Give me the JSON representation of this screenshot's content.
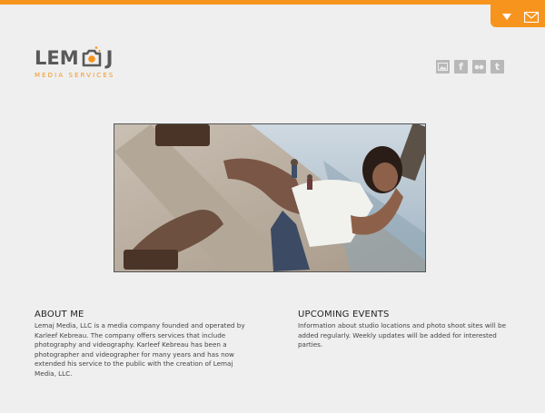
{
  "logo": {
    "left_text": "LEM",
    "right_text": "J",
    "tagline": "MEDIA SERVICES"
  },
  "top_tab": {
    "icons": [
      "dropdown-arrow-icon",
      "mail-icon"
    ]
  },
  "social": {
    "icons": [
      "image-gallery-icon",
      "facebook-icon",
      "flickr-icon",
      "twitter-icon"
    ],
    "facebook_glyph": "f",
    "twitter_glyph": "t"
  },
  "colors": {
    "accent": "#f7941d",
    "background": "#efefef",
    "icon_gray": "#b8b8b8",
    "logo_gray": "#595959"
  },
  "about": {
    "heading": "ABOUT ME",
    "body": "Lemaj Media, LLC is a media company founded and operated by Karleef Kebreau.  The company offers services that include photography and videography.  Karleef Kebreau has been a photographer and videographer for many years and has now extended his service to the public with the creation of Lemaj Media, LLC."
  },
  "events": {
    "heading": "UPCOMING EVENTS",
    "body": "Information about studio locations and photo shoot sites will be added regularly. Weekly updates will be added for interested parties."
  }
}
